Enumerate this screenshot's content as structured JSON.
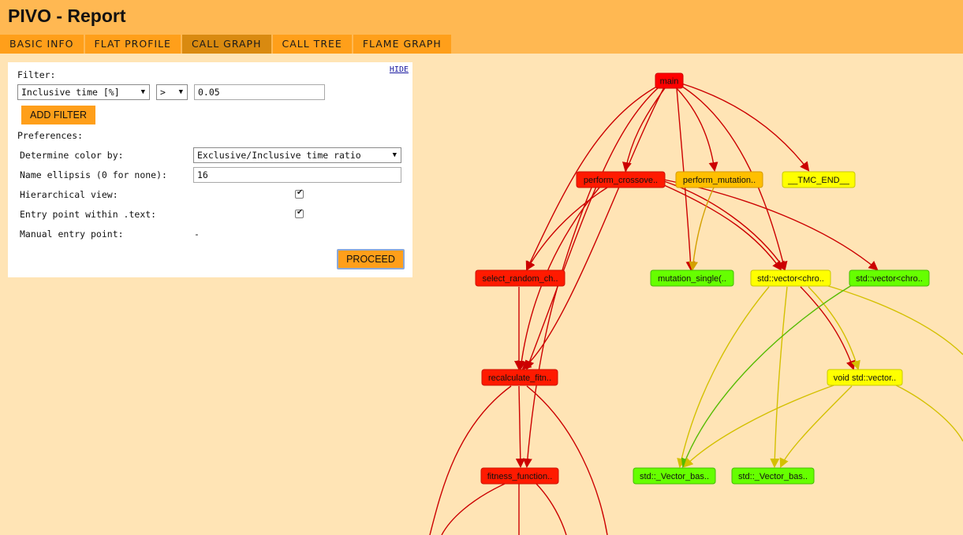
{
  "app": {
    "title": "PIVO - Report"
  },
  "tabs": [
    {
      "label": "BASIC INFO"
    },
    {
      "label": "FLAT PROFILE"
    },
    {
      "label": "CALL GRAPH"
    },
    {
      "label": "CALL TREE"
    },
    {
      "label": "FLAME GRAPH"
    }
  ],
  "filter": {
    "heading": "Filter:",
    "hide_label": "HIDE",
    "metric": "Inclusive time [%]",
    "operator": ">",
    "value": "0.05",
    "add_label": "ADD FILTER"
  },
  "preferences": {
    "heading": "Preferences:",
    "color_label": "Determine color by:",
    "color_value": "Exclusive/Inclusive time ratio",
    "ellipsis_label": "Name ellipsis (0 for none):",
    "ellipsis_value": "16",
    "hier_label": "Hierarchical view:",
    "hier_checked": true,
    "entry_text_label": "Entry point within .text:",
    "entry_text_checked": true,
    "manual_label": "Manual entry point:",
    "manual_value": "-",
    "proceed_label": "PROCEED"
  },
  "colors": {
    "header_bg": "#ffb852",
    "tab_bg": "#ff9f1a",
    "tab_active_bg": "#d98a10",
    "page_bg": "#ffe4b5",
    "edge_red": "#cc0000",
    "edge_yellow": "#d4c000",
    "edge_green": "#55bb00",
    "edge_orange": "#d4a000"
  },
  "graph": {
    "nodes": [
      {
        "id": "main",
        "label": "main",
        "fill": "#ff0000",
        "stroke": "#cc0000"
      },
      {
        "id": "crossover",
        "label": "perform_crossove..",
        "fill": "#ff1a00",
        "stroke": "#cc1100"
      },
      {
        "id": "mutation",
        "label": "perform_mutation..",
        "fill": "#ffbf00",
        "stroke": "#d49a00"
      },
      {
        "id": "tmc",
        "label": "__TMC_END__",
        "fill": "#ffff00",
        "stroke": "#c8c800"
      },
      {
        "id": "select",
        "label": "select_random_ch..",
        "fill": "#ff1a00",
        "stroke": "#cc1100"
      },
      {
        "id": "mutsingle",
        "label": "mutation_single(..",
        "fill": "#66ff00",
        "stroke": "#44bb00"
      },
      {
        "id": "vecchro1",
        "label": "std::vector<chro..",
        "fill": "#ffff00",
        "stroke": "#c8c800"
      },
      {
        "id": "vecchro2",
        "label": "std::vector<chro..",
        "fill": "#66ff00",
        "stroke": "#44bb00"
      },
      {
        "id": "recalc",
        "label": "recalculate_fitn..",
        "fill": "#ff1a00",
        "stroke": "#cc1100"
      },
      {
        "id": "voidvec",
        "label": "void std::vector..",
        "fill": "#ffff00",
        "stroke": "#c8c800"
      },
      {
        "id": "fitness",
        "label": "fitness_function..",
        "fill": "#ff1a00",
        "stroke": "#cc1100"
      },
      {
        "id": "vecbas1",
        "label": "std::_Vector_bas..",
        "fill": "#66ff00",
        "stroke": "#44bb00"
      },
      {
        "id": "vecbas2",
        "label": "std::_Vector_bas..",
        "fill": "#66ff00",
        "stroke": "#44bb00"
      }
    ]
  }
}
